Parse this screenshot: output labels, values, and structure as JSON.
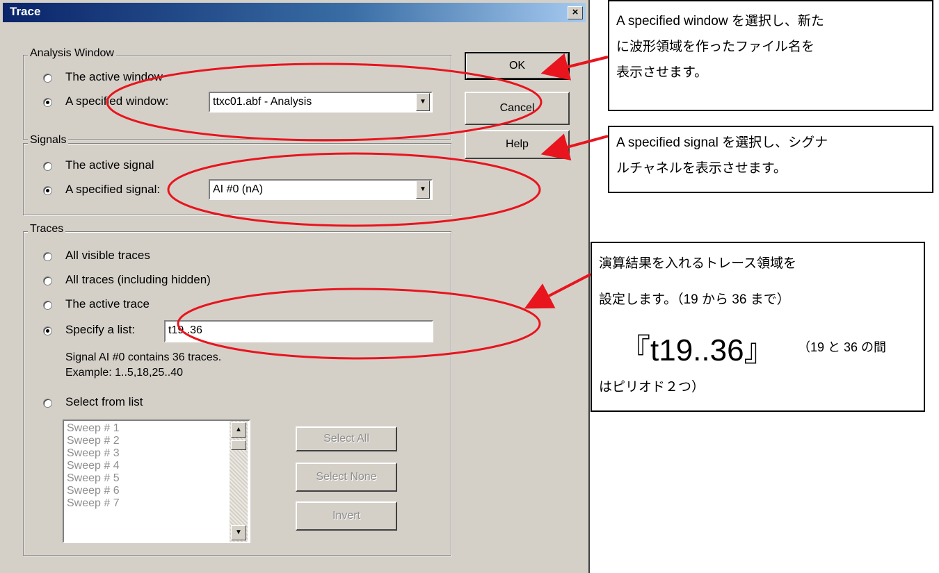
{
  "dialog": {
    "title": "Trace",
    "close_label": "×",
    "buttons": {
      "ok": "OK",
      "cancel": "Cancel",
      "help": "Help"
    },
    "analysis_window": {
      "legend": "Analysis Window",
      "option_active": "The active window",
      "option_specified": "A specified window:",
      "selected_value": "ttxc01.abf - Analysis"
    },
    "signals": {
      "legend": "Signals",
      "option_active": "The active signal",
      "option_specified": "A specified signal:",
      "selected_value": "AI #0 (nA)"
    },
    "traces": {
      "legend": "Traces",
      "option_all_visible": "All visible traces",
      "option_all": "All traces (including hidden)",
      "option_active": "The active trace",
      "option_specify_list": "Specify a list:",
      "list_value": "t19..36",
      "info_line1": "Signal AI #0 contains 36 traces.",
      "info_line2": "Example: 1..5,18,25..40",
      "option_select_from_list": "Select from list",
      "sweeps": [
        "Sweep # 1",
        "Sweep # 2",
        "Sweep # 3",
        "Sweep # 4",
        "Sweep # 5",
        "Sweep # 6",
        "Sweep # 7"
      ],
      "select_all": "Select All",
      "select_none": "Select None",
      "invert": "Invert"
    }
  },
  "callouts": {
    "window": "A specified window を選択し、新た\nに波形領域を作ったファイル名を\n表示させます。",
    "signal": "A specified signal を選択し、シグナ\nルチャネルを表示させます。",
    "trace_line1": "演算結果を入れるトレース領域を",
    "trace_line2": "設定します。（19 から 36 まで）",
    "trace_big": "『t19..36』",
    "trace_small": "（19 と 36 の間",
    "trace_line4": "はピリオド２つ）"
  },
  "colors": {
    "annotation": "#e8141e",
    "title_bar": "#0a246a",
    "dialog_bg": "#d4d0c8"
  }
}
